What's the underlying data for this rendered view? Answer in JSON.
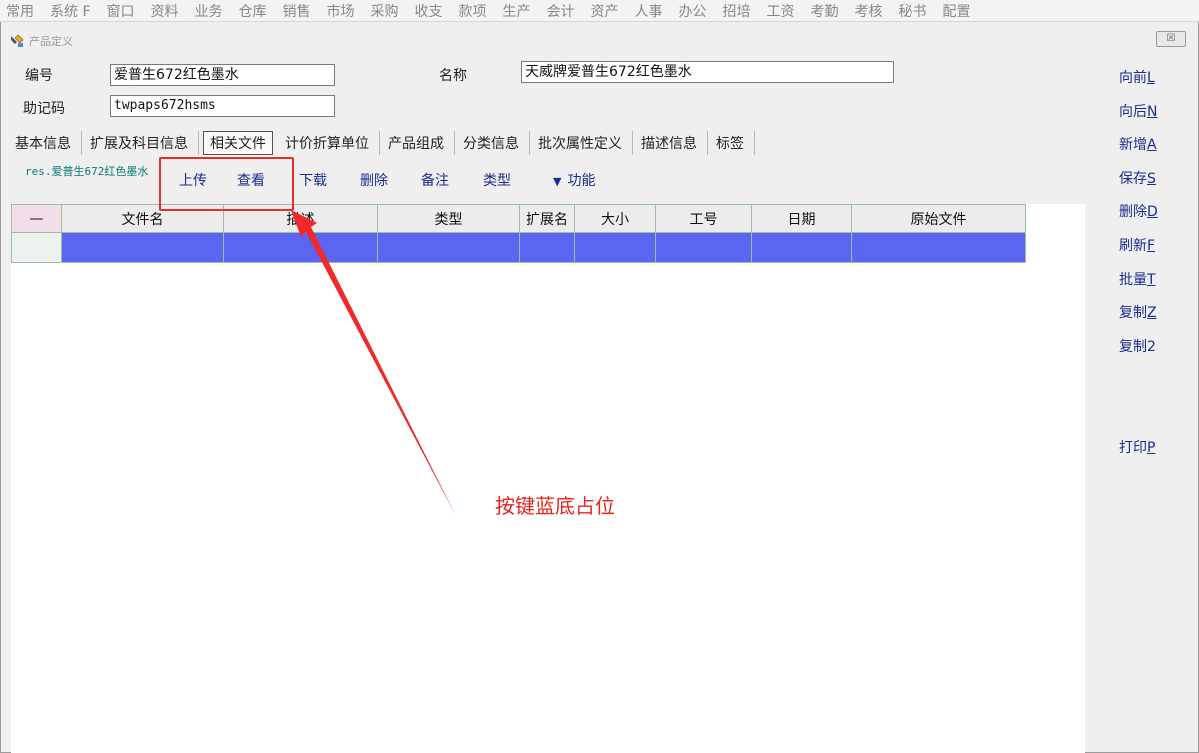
{
  "menu": [
    "常用",
    "系统 F",
    "窗口",
    "资料",
    "业务",
    "仓库",
    "销售",
    "市场",
    "采购",
    "收支",
    "款项",
    "生产",
    "会计",
    "资产",
    "人事",
    "办公",
    "招培",
    "工资",
    "考勤",
    "考核",
    "秘书",
    "配置"
  ],
  "window": {
    "title": "产品定义",
    "close_label": "☒"
  },
  "form": {
    "code_label": "编号",
    "code_value": "爱普生672红色墨水",
    "name_label": "名称",
    "name_value": "天威牌爱普生672红色墨水",
    "mnemonic_label": "助记码",
    "mnemonic_value": "twpaps672hsms"
  },
  "tabs": [
    "基本信息",
    "扩展及科目信息",
    "相关文件",
    "计价折算单位",
    "产品组成",
    "分类信息",
    "批次属性定义",
    "描述信息",
    "标签"
  ],
  "active_tab": "相关文件",
  "file_path": "res.爱普生672红色墨水",
  "toolbar": {
    "upload": "上传",
    "view": "查看",
    "download": "下载",
    "delete": "删除",
    "note": "备注",
    "type": "类型",
    "function": "功能"
  },
  "grid": {
    "corner": "—",
    "columns": [
      "文件名",
      "描述",
      "类型",
      "扩展名",
      "大小",
      "工号",
      "日期",
      "原始文件"
    ]
  },
  "side_actions": [
    {
      "label": "向前",
      "key": "L"
    },
    {
      "label": "向后",
      "key": "N"
    },
    {
      "label": "新增",
      "key": "A"
    },
    {
      "label": "保存",
      "key": "S"
    },
    {
      "label": "删除",
      "key": "D"
    },
    {
      "label": "刷新",
      "key": "F"
    },
    {
      "label": "批量",
      "key": "T"
    },
    {
      "label": "复制",
      "key": "Z"
    },
    {
      "label": "复制",
      "key": "2"
    },
    {
      "label": "打印",
      "key": "P"
    }
  ],
  "annotation": {
    "text": "按键蓝底占位",
    "color": "#e8231c"
  },
  "colors": {
    "selected_row": "#5b65f1",
    "link_blue": "#1a2d8f",
    "annotation_red": "#ee2a2a"
  }
}
